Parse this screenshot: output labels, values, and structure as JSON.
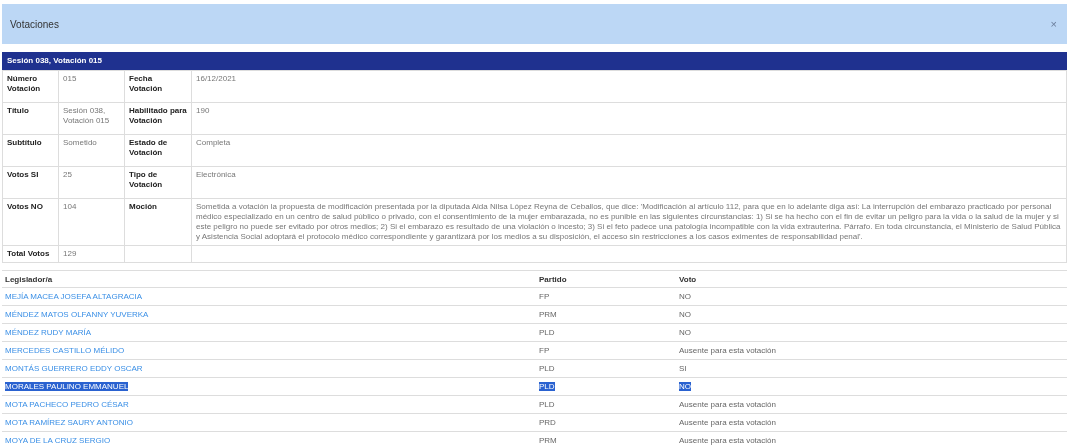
{
  "window": {
    "title": "Votaciones",
    "close": "×"
  },
  "session_banner": "Sesión 038, Votación 015",
  "details": [
    [
      {
        "label": "Número Votación",
        "value": "015"
      },
      {
        "label": "Fecha Votación",
        "value": "16/12/2021"
      }
    ],
    [
      {
        "label": "Título",
        "value": "Sesión 038, Votación 015"
      },
      {
        "label": "Habilitado para Votación",
        "value": "190"
      }
    ],
    [
      {
        "label": "Subtítulo",
        "value": "Sometido"
      },
      {
        "label": "Estado de Votación",
        "value": "Completa"
      }
    ],
    [
      {
        "label": "Votos SI",
        "value": "25"
      },
      {
        "label": "Tipo de Votación",
        "value": "Electrónica"
      }
    ],
    [
      {
        "label": "Votos NO",
        "value": "104"
      },
      {
        "label": "Moción",
        "value": "Sometida a votación la propuesta de modificación presentada por la diputada Aida Nilsa López Reyna de Ceballos, que dice: 'Modificación al artículo 112, para que en lo adelante diga así: La interrupción del embarazo practicado por personal médico especializado en un centro de salud público o privado, con el consentimiento de la mujer embarazada, no es punible en las siguientes circunstancias: 1) Si se ha hecho con el fin de evitar un peligro para la vida o la salud de la mujer y si este peligro no puede ser evitado por otros medios; 2) Si el embarazo es resultado de una violación o incesto; 3) Si el feto padece una patología incompatible con la vida extrauterina. Párrafo. En toda circunstancia, el Ministerio de Salud Pública y Asistencia Social adoptará el protocolo médico correspondiente y garantizará por los medios a su disposición, el acceso sin restricciones a los casos eximentes de responsabilidad penal'."
      }
    ],
    [
      {
        "label": "Total Votos",
        "value": "129"
      }
    ]
  ],
  "legislators": {
    "columns": [
      "Legislador/a",
      "Partido",
      "Voto"
    ],
    "rows": [
      {
        "name": "MEJÍA MACEA JOSEFA ALTAGRACIA",
        "party": "FP",
        "vote": "NO",
        "highlighted": false
      },
      {
        "name": "MÉNDEZ MATOS OLFANNY YUVERKA",
        "party": "PRM",
        "vote": "NO",
        "highlighted": false
      },
      {
        "name": "MÉNDEZ RUDY MARÍA",
        "party": "PLD",
        "vote": "NO",
        "highlighted": false
      },
      {
        "name": "MERCEDES CASTILLO MÉLIDO",
        "party": "FP",
        "vote": "Ausente para esta votación",
        "highlighted": false
      },
      {
        "name": "MONTÁS GUERRERO EDDY OSCAR",
        "party": "PLD",
        "vote": "SI",
        "highlighted": false
      },
      {
        "name": "MORALES PAULINO EMMANUEL",
        "party": "PLD",
        "vote": "NO",
        "highlighted": true
      },
      {
        "name": "MOTA PACHECO PEDRO CÉSAR",
        "party": "PLD",
        "vote": "Ausente para esta votación",
        "highlighted": false
      },
      {
        "name": "MOTA RAMÍREZ SAURY ANTONIO",
        "party": "PRD",
        "vote": "Ausente para esta votación",
        "highlighted": false
      },
      {
        "name": "MOYA DE LA CRUZ SERGIO",
        "party": "PRM",
        "vote": "Ausente para esta votación",
        "highlighted": false
      }
    ]
  }
}
